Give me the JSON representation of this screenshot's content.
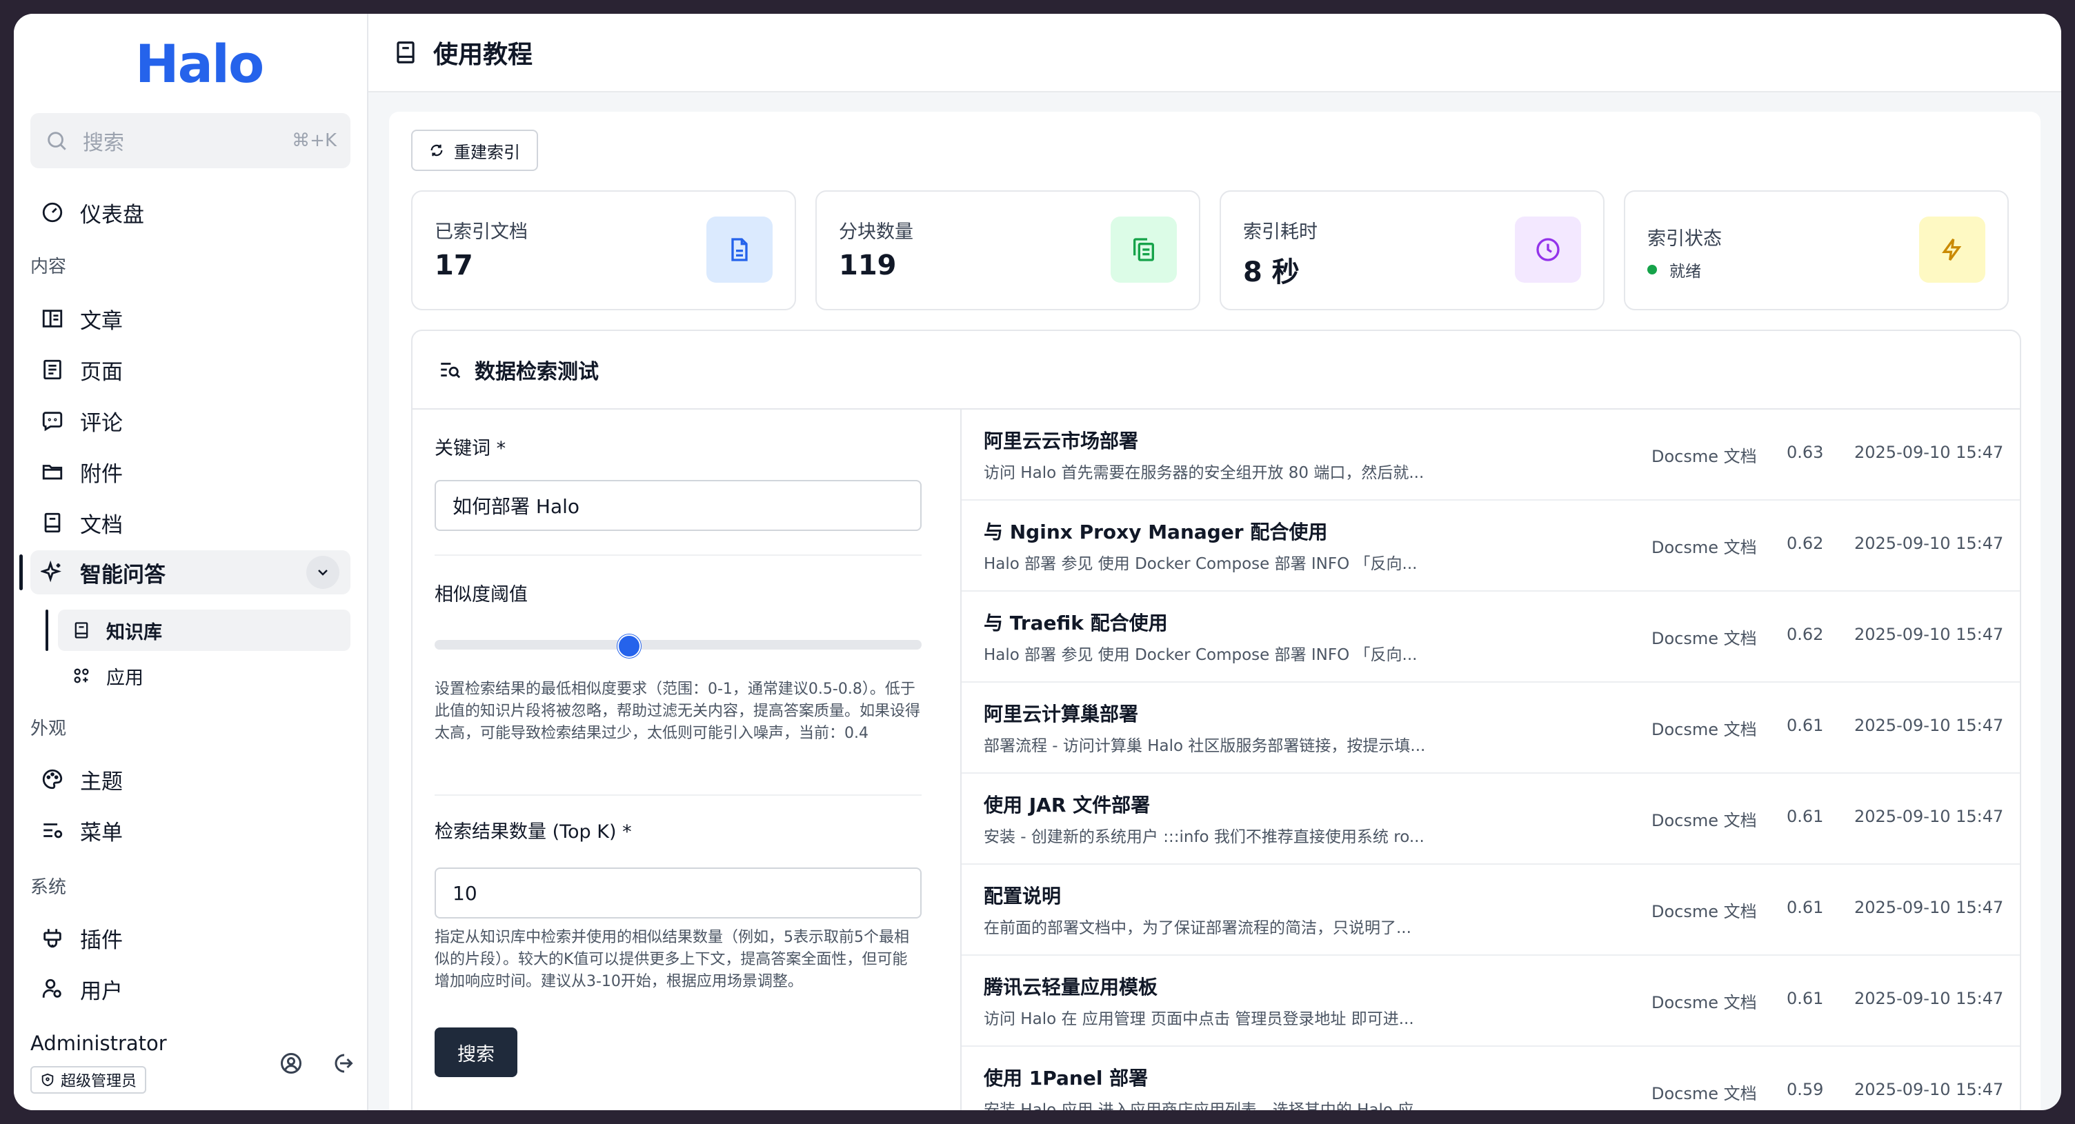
{
  "app": {
    "logo": "Halo"
  },
  "search": {
    "placeholder": "搜索",
    "shortcut": "⌘+K"
  },
  "sidebar": {
    "dashboard": "仪表盘",
    "sections": {
      "content": "内容",
      "appearance": "外观",
      "system": "系统"
    },
    "content_items": [
      "文章",
      "页面",
      "评论",
      "附件",
      "文档",
      "智能问答"
    ],
    "ai_sub_items": [
      "知识库",
      "应用"
    ],
    "appearance_items": [
      "主题",
      "菜单"
    ],
    "system_items": [
      "插件",
      "用户"
    ],
    "user": {
      "name": "Administrator",
      "role": "超级管理员"
    }
  },
  "header": {
    "title": "使用教程"
  },
  "toolbar": {
    "rebuild_label": "重建索引"
  },
  "stats": [
    {
      "label": "已索引文档",
      "value": "17",
      "icon": "document-icon",
      "color": "#dbeafe"
    },
    {
      "label": "分块数量",
      "value": "119",
      "icon": "copy-icon",
      "color": "#dcfce7"
    },
    {
      "label": "索引耗时",
      "value": "8 秒",
      "icon": "clock-icon",
      "color": "#f3e8ff"
    },
    {
      "label": "索引状态",
      "value": "就绪",
      "icon": "bolt-icon",
      "color": "#fef9c3"
    }
  ],
  "test": {
    "title": "数据检索测试",
    "keyword_label": "关键词 *",
    "keyword_value": "如何部署 Halo",
    "threshold_label": "相似度阈值",
    "threshold_value": 0.4,
    "threshold_help": "设置检索结果的最低相似度要求（范围：0-1，通常建议0.5-0.8）。低于此值的知识片段将被忽略，帮助过滤无关内容，提高答案质量。如果设得太高，可能导致检索结果过少，太低则可能引入噪声，当前：0.4",
    "topk_label": "检索结果数量 (Top K) *",
    "topk_value": "10",
    "topk_help": "指定从知识库中检索并使用的相似结果数量（例如，5表示取前5个最相似的片段）。较大的K值可以提供更多上下文，提高答案全面性，但可能增加响应时间。建议从3-10开始，根据应用场景调整。",
    "search_button": "搜索"
  },
  "results": [
    {
      "title": "阿里云云市场部署",
      "desc": "访问 Halo 首先需要在服务器的安全组开放 80 端口，然后就...",
      "source": "Docsme 文档",
      "score": "0.63",
      "date": "2025-09-10 15:47"
    },
    {
      "title": "与 Nginx Proxy Manager 配合使用",
      "desc": "Halo 部署 参见 使用 Docker Compose 部署 INFO 「反向...",
      "source": "Docsme 文档",
      "score": "0.62",
      "date": "2025-09-10 15:47"
    },
    {
      "title": "与 Traefik 配合使用",
      "desc": "Halo 部署 参见 使用 Docker Compose 部署 INFO 「反向...",
      "source": "Docsme 文档",
      "score": "0.62",
      "date": "2025-09-10 15:47"
    },
    {
      "title": "阿里云计算巢部署",
      "desc": "部署流程 - 访问计算巢 Halo 社区版服务部署链接，按提示填...",
      "source": "Docsme 文档",
      "score": "0.61",
      "date": "2025-09-10 15:47"
    },
    {
      "title": "使用 JAR 文件部署",
      "desc": "安装 - 创建新的系统用户 :::info 我们不推荐直接使用系统 ro...",
      "source": "Docsme 文档",
      "score": "0.61",
      "date": "2025-09-10 15:47"
    },
    {
      "title": "配置说明",
      "desc": "在前面的部署文档中，为了保证部署流程的简洁，只说明了...",
      "source": "Docsme 文档",
      "score": "0.61",
      "date": "2025-09-10 15:47"
    },
    {
      "title": "腾讯云轻量应用模板",
      "desc": "访问 Halo 在 应用管理 页面中点击 管理员登录地址 即可进...",
      "source": "Docsme 文档",
      "score": "0.61",
      "date": "2025-09-10 15:47"
    },
    {
      "title": "使用 1Panel 部署",
      "desc": "安装 Halo 应用 进入应用商店应用列表，选择其中的 Halo 应...",
      "source": "Docsme 文档",
      "score": "0.59",
      "date": "2025-09-10 15:47"
    }
  ]
}
